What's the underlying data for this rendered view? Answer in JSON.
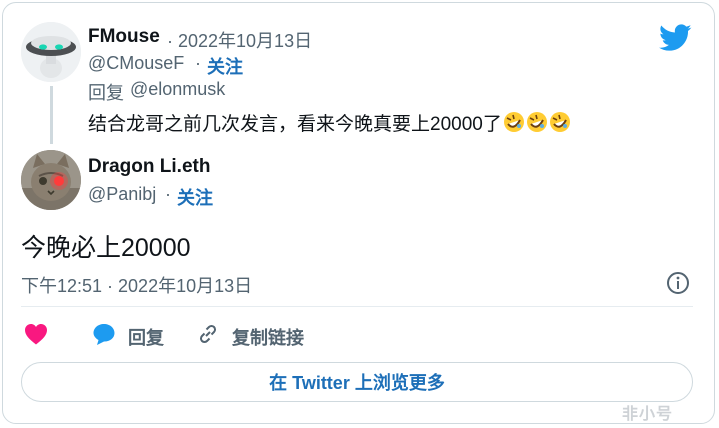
{
  "reply_tweet": {
    "author_name": "FMouse",
    "date": "· 2022年10月13日",
    "handle": "@CMouseF",
    "follow_sep": "·",
    "follow_label": "关注",
    "reply_to_prefix": "回复",
    "reply_to_handle": "@elonmusk",
    "text": "结合龙哥之前几次发言，看来今晚真要上20000了",
    "emoji": "rolling-on-floor-laughing-emoji ×3"
  },
  "main_tweet": {
    "author_name": "Dragon Li.eth",
    "handle": "@Panibj",
    "follow_sep": "·",
    "follow_label": "关注",
    "text": "今晚必上20000",
    "timestamp": "下午12:51 · 2022年10月13日"
  },
  "actions": {
    "like_icon": "heart-icon",
    "reply_label": "回复",
    "copy_link_label": "复制链接"
  },
  "more_button": {
    "label": "在 Twitter 上浏览更多"
  },
  "watermark": "非小号",
  "colors": {
    "twitter_blue": "#1d9bf0",
    "link_blue": "#1d6fb8",
    "heart": "#f91880",
    "gray_text": "#536471",
    "border": "#cfd9de"
  }
}
